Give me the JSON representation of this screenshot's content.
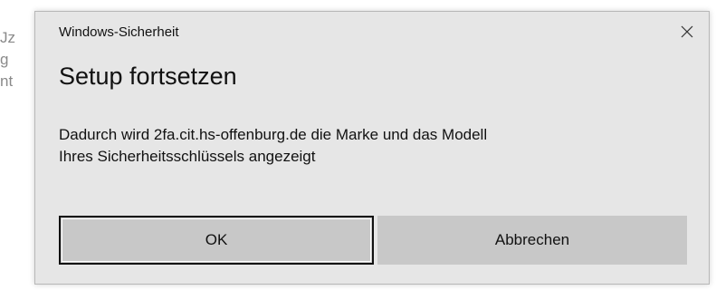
{
  "background": {
    "fragments": [
      "Jz",
      "g",
      "nt"
    ]
  },
  "dialog": {
    "window_title": "Windows-Sicherheit",
    "close_icon": "close-icon",
    "heading": "Setup fortsetzen",
    "message_line1": "Dadurch wird 2fa.cit.hs-offenburg.de die Marke und das Modell",
    "message_line2": "Ihres Sicherheitsschlüssels angezeigt",
    "ok_label": "OK",
    "cancel_label": "Abbrechen"
  },
  "colors": {
    "dialog_background": "#e6e6e6",
    "button_background": "#c8c8c8",
    "text": "#111111"
  }
}
